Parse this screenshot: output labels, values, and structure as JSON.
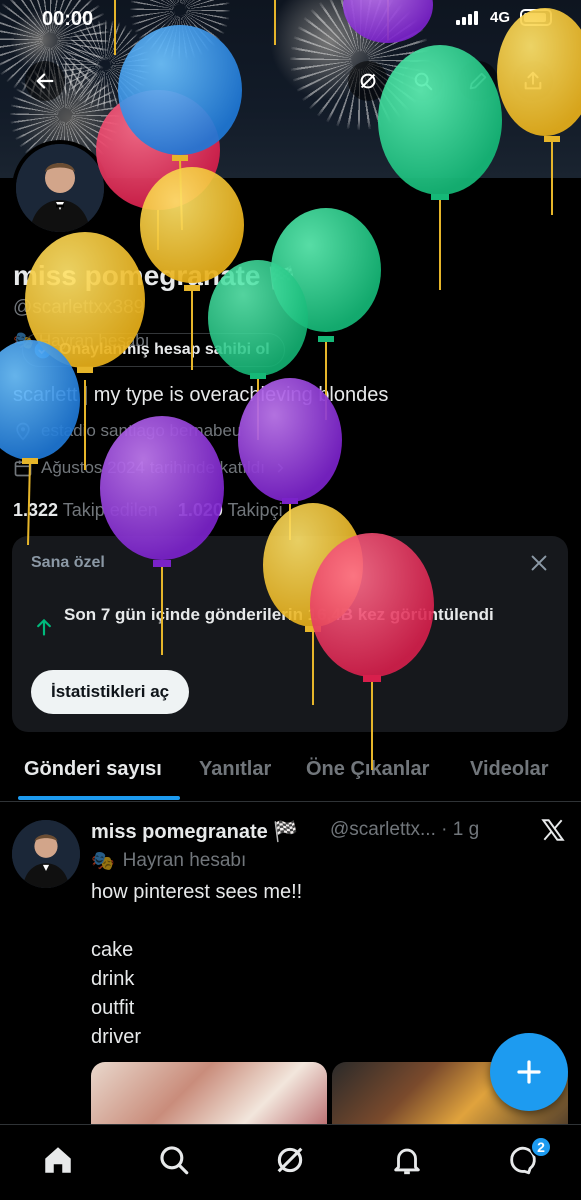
{
  "status_bar": {
    "time": "00:00",
    "network": "4G"
  },
  "profile": {
    "display_name": "miss pomegranate",
    "name_emoji": "🏁",
    "handle": "@scarlettxx389",
    "fan_label": "Hayran hesabı",
    "verify_pill": "Onaylanmış hesap sahibi ol",
    "bio": "scarlett | my type is overachieving blondes",
    "location": "estadio santiago bernabeu",
    "joined": "Ağustos 2024 tarihinde katıldı",
    "following_count": "1.322",
    "following_label": "Takip edilen",
    "followers_count": "1.020",
    "followers_label": "Takipçi"
  },
  "card": {
    "title": "Sana özel",
    "text": "Son 7 gün içinde gönderilerin 16,4B kez görüntülendi",
    "button": "İstatistikleri aç"
  },
  "tabs": [
    {
      "label": "Gönderi sayısı",
      "active": true
    },
    {
      "label": "Yanıtlar"
    },
    {
      "label": "Öne Çıkanlar"
    },
    {
      "label": "Videolar"
    }
  ],
  "post": {
    "name": "miss pomegranate 🏁",
    "handle": "@scarlettx...",
    "time": "· 1 g",
    "fan_label": "Hayran hesabı",
    "text": "how pinterest sees me!!\n\ncake\ndrink\noutfit\ndriver"
  },
  "nav": {
    "messages_badge": "2"
  },
  "colors": {
    "accent": "#1d9bf0",
    "background": "#000000",
    "card": "#16181c",
    "muted": "#71767b"
  },
  "icons": [
    "back-arrow-icon",
    "grok-icon",
    "search-icon",
    "edit-icon",
    "share-icon",
    "verified-icon",
    "location-icon",
    "calendar-icon",
    "chevron-right-icon",
    "close-icon",
    "up-arrow-icon",
    "x-logo-icon",
    "plus-icon",
    "home-icon",
    "notifications-icon",
    "messages-icon"
  ]
}
